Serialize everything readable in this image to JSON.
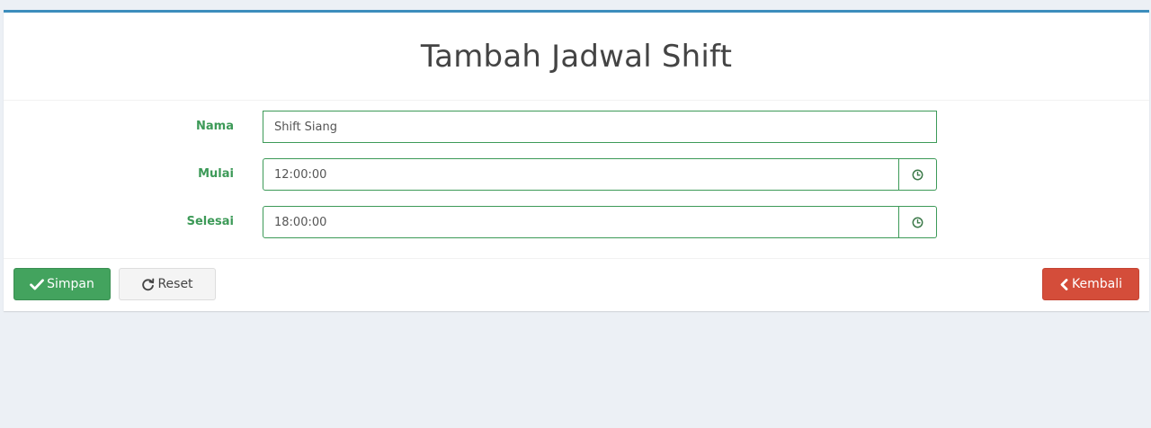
{
  "page": {
    "title": "Tambah Jadwal Shift"
  },
  "form": {
    "fields": [
      {
        "label": "Nama",
        "value": "Shift Siang"
      },
      {
        "label": "Mulai",
        "value": "12:00:00",
        "icon": "clock-icon"
      },
      {
        "label": "Selesai",
        "value": "18:00:00",
        "icon": "clock-icon"
      }
    ]
  },
  "actions": {
    "save_label": "Simpan",
    "save_icon": "check-icon",
    "reset_label": "Reset",
    "reset_icon": "refresh-icon",
    "back_label": "Kembali",
    "back_icon": "chevron-left-icon"
  },
  "colors": {
    "accent_top": "#3c8dbc",
    "label_green": "#3d9a58",
    "success": "#43a35e",
    "danger": "#d44d3a",
    "background": "#ecf0f5"
  }
}
